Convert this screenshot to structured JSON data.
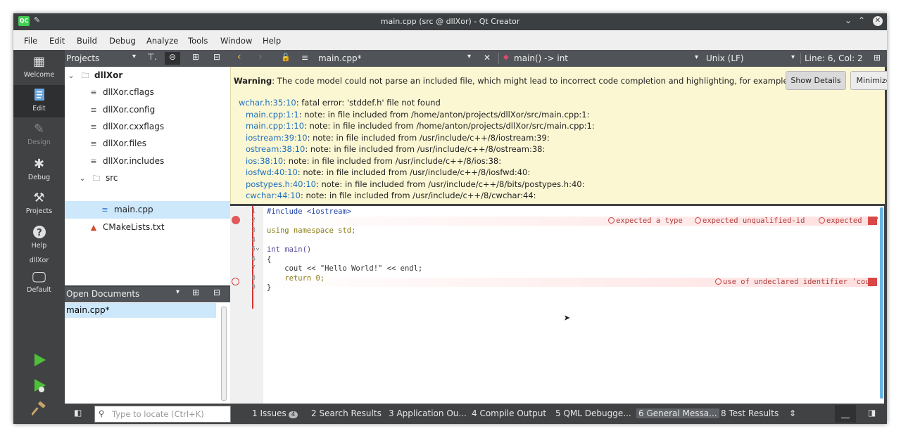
{
  "window": {
    "title": "main.cpp (src @ dllXor) - Qt Creator",
    "app_icon": "QC"
  },
  "menu": [
    "File",
    "Edit",
    "Build",
    "Debug",
    "Analyze",
    "Tools",
    "Window",
    "Help"
  ],
  "modes": [
    {
      "label": "Welcome",
      "icon": "grid-icon"
    },
    {
      "label": "Edit",
      "icon": "edit-document-icon"
    },
    {
      "label": "Design",
      "icon": "pen-icon"
    },
    {
      "label": "Debug",
      "icon": "bug-icon"
    },
    {
      "label": "Projects",
      "icon": "wrench-icon"
    },
    {
      "label": "Help",
      "icon": "help-icon"
    }
  ],
  "kit": {
    "project": "dllXor",
    "label": "Default"
  },
  "projects_panel": {
    "title": "Projects",
    "tree": [
      {
        "label": "dllXor",
        "bold": true
      },
      {
        "label": "dllXor.cflags"
      },
      {
        "label": "dllXor.config"
      },
      {
        "label": "dllXor.cxxflags"
      },
      {
        "label": "dllXor.files"
      },
      {
        "label": "dllXor.includes"
      },
      {
        "label": "src"
      },
      {
        "label": "main.cpp",
        "selected": true
      },
      {
        "label": "CMakeLists.txt"
      }
    ]
  },
  "open_documents": {
    "title": "Open Documents",
    "items": [
      "main.cpp*"
    ]
  },
  "editor": {
    "file": "main.cpp*",
    "symbol": "main() -> int",
    "line_ending": "Unix (LF)",
    "position": "Line: 6, Col: 2"
  },
  "warning": {
    "label": "Warning",
    "text": ": The code model could not parse an included file, which might lead to incorrect code completion and highlighting, for example.",
    "show_details": "Show Details",
    "minimize": "Minimize",
    "diagnostics": [
      {
        "link": "wchar.h:35:10",
        "text": ": fatal error: 'stddef.h' file not found"
      },
      {
        "link": "main.cpp:1:1",
        "text": ": note: in file included from /home/anton/projects/dllXor/src/main.cpp:1:"
      },
      {
        "link": "main.cpp:1:10",
        "text": ": note: in file included from /home/anton/projects/dllXor/src/main.cpp:1:"
      },
      {
        "link": "iostream:39:10",
        "text": ": note: in file included from /usr/include/c++/8/iostream:39:"
      },
      {
        "link": "ostream:38:10",
        "text": ": note: in file included from /usr/include/c++/8/ostream:38:"
      },
      {
        "link": "ios:38:10",
        "text": ": note: in file included from /usr/include/c++/8/ios:38:"
      },
      {
        "link": "iosfwd:40:10",
        "text": ": note: in file included from /usr/include/c++/8/iosfwd:40:"
      },
      {
        "link": "postypes.h:40:10",
        "text": ": note: in file included from /usr/include/c++/8/bits/postypes.h:40:"
      },
      {
        "link": "cwchar:44:10",
        "text": ": note: in file included from /usr/include/c++/8/cwchar:44:"
      }
    ]
  },
  "code": {
    "lines": [
      {
        "n": "1",
        "text": "#include <iostream>"
      },
      {
        "n": "2",
        "text": ""
      },
      {
        "n": "3",
        "text": "using namespace std;"
      },
      {
        "n": "4",
        "text": ""
      },
      {
        "n": "5",
        "text": "int main()"
      },
      {
        "n": "6",
        "text": "{"
      },
      {
        "n": "7",
        "text": "    cout << \"Hello World!\" << endl;"
      },
      {
        "n": "8",
        "text": "    return 0;"
      },
      {
        "n": "9",
        "text": "}"
      }
    ],
    "errors_line2": [
      "expected a type",
      "expected unqualified-id",
      "expected '}'"
    ],
    "error_line7": "use of undeclared identifier 'cout'"
  },
  "locator": {
    "placeholder": "Type to locate (Ctrl+K)"
  },
  "output_tabs": [
    {
      "label": "1  Issues",
      "badge": "4"
    },
    {
      "label": "2  Search Results"
    },
    {
      "label": "3  Application Ou..."
    },
    {
      "label": "4  Compile Output"
    },
    {
      "label": "5  QML Debugge..."
    },
    {
      "label": "6  General Messa...",
      "active": true
    },
    {
      "label": "8  Test Results"
    }
  ],
  "colors": {
    "accent_blue": "#6bb5e5",
    "error_red": "#d94848",
    "warning_bg": "#fbf7d3",
    "selection": "#cde7fb"
  }
}
